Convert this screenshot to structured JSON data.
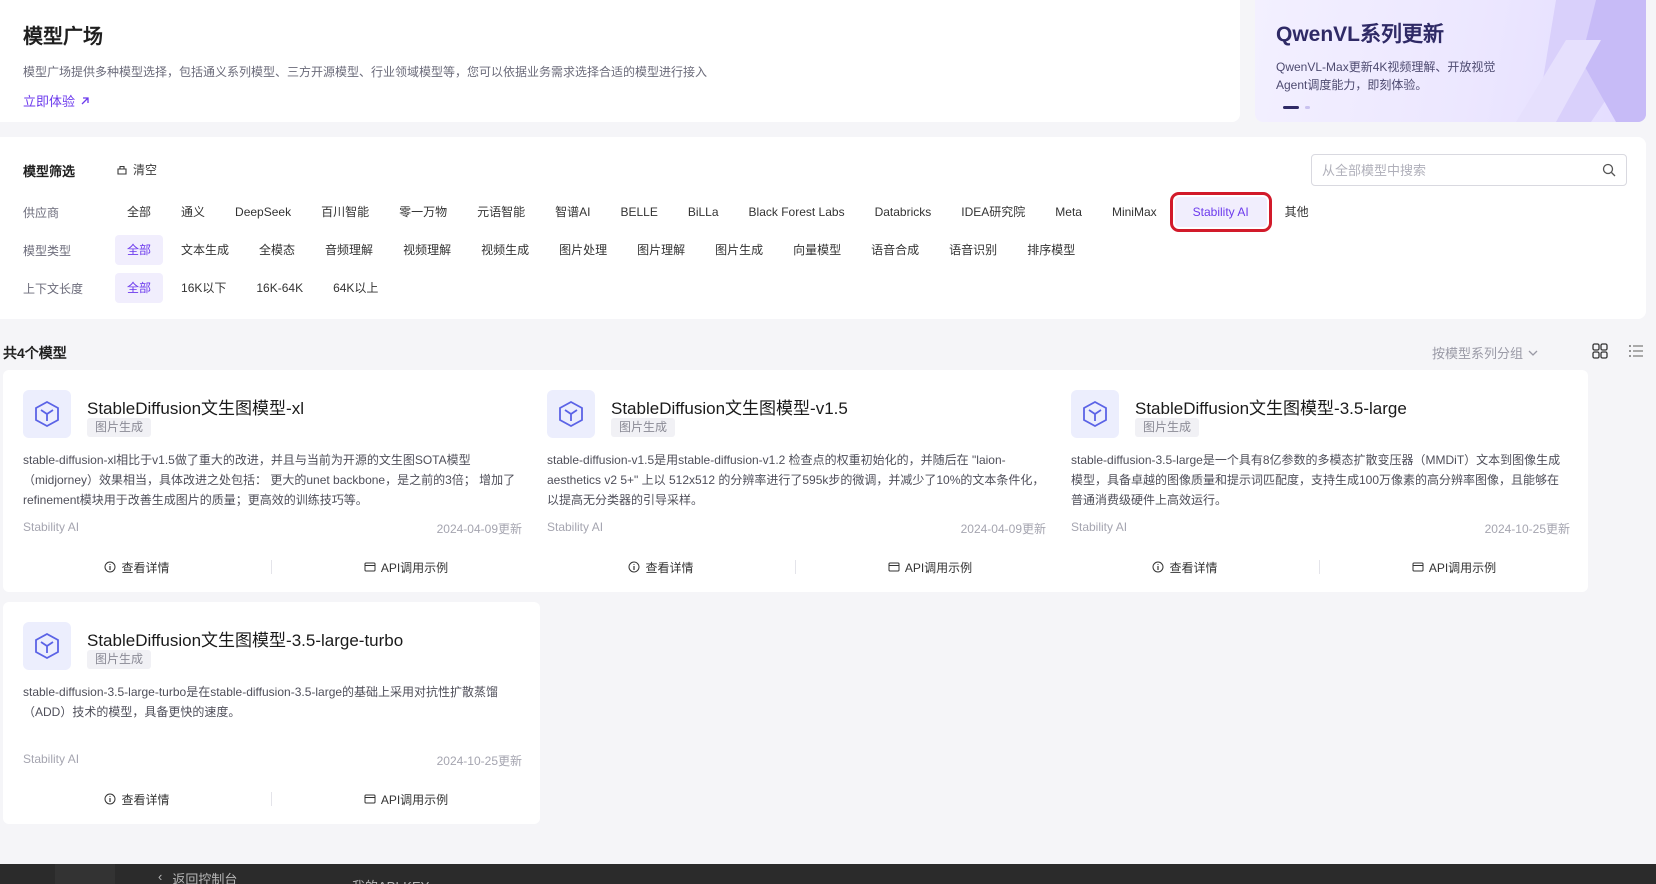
{
  "hero": {
    "title": "模型广场",
    "description": "模型广场提供多种模型选择，包括通义系列模型、三方开源模型、行业领域模型等，您可以依据业务需求选择合适的模型进行接入",
    "try_link": "立即体验"
  },
  "banner": {
    "title": "QwenVL系列更新",
    "text": "QwenVL-Max更新4K视频理解、开放视觉Agent调度能力，即刻体验。"
  },
  "filter": {
    "title": "模型筛选",
    "clear": "清空",
    "search_placeholder": "从全部模型中搜索",
    "provider_label": "供应商",
    "providers": [
      "全部",
      "通义",
      "DeepSeek",
      "百川智能",
      "零一万物",
      "元语智能",
      "智谱AI",
      "BELLE",
      "BiLLa",
      "Black Forest Labs",
      "Databricks",
      "IDEA研究院",
      "Meta",
      "MiniMax",
      "Stability AI",
      "其他"
    ],
    "selected_provider": "Stability AI",
    "type_label": "模型类型",
    "types": [
      "全部",
      "文本生成",
      "全模态",
      "音频理解",
      "视频理解",
      "视频生成",
      "图片处理",
      "图片理解",
      "图片生成",
      "向量模型",
      "语音合成",
      "语音识别",
      "排序模型"
    ],
    "selected_type": "全部",
    "context_label": "上下文长度",
    "contexts": [
      "全部",
      "16K以下",
      "16K-64K",
      "64K以上"
    ],
    "selected_context": "全部"
  },
  "list": {
    "count_text": "共4个模型",
    "group_by": "按模型系列分组"
  },
  "cards": [
    {
      "name": "StableDiffusion文生图模型-xl",
      "tag": "图片生成",
      "description": "stable-diffusion-xl相比于v1.5做了重大的改进，并且与当前为开源的文生图SOTA模型（midjorney）效果相当，具体改进之处包括： 更大的unet backbone，是之前的3倍； 增加了refinement模块用于改善生成图片的质量；更高效的训练技巧等。",
      "provider": "Stability AI",
      "updated": "2024-04-09更新",
      "detail": "查看详情",
      "api": "API调用示例"
    },
    {
      "name": "StableDiffusion文生图模型-v1.5",
      "tag": "图片生成",
      "description": "stable-diffusion-v1.5是用stable-diffusion-v1.2 检查点的权重初始化的，并随后在 \"laion-aesthetics v2 5+\" 上以 512x512 的分辨率进行了595k步的微调，并减少了10%的文本条件化，以提高无分类器的引导采样。",
      "provider": "Stability AI",
      "updated": "2024-04-09更新",
      "detail": "查看详情",
      "api": "API调用示例"
    },
    {
      "name": "StableDiffusion文生图模型-3.5-large",
      "tag": "图片生成",
      "description": "stable-diffusion-3.5-large是一个具有8亿参数的多模态扩散变压器（MMDiT）文本到图像生成模型，具备卓越的图像质量和提示词匹配度，支持生成100万像素的高分辨率图像，且能够在普通消费级硬件上高效运行。",
      "provider": "Stability AI",
      "updated": "2024-10-25更新",
      "detail": "查看详情",
      "api": "API调用示例"
    },
    {
      "name": "StableDiffusion文生图模型-3.5-large-turbo",
      "tag": "图片生成",
      "description": "stable-diffusion-3.5-large-turbo是在stable-diffusion-3.5-large的基础上采用对抗性扩散蒸馏（ADD）技术的模型，具备更快的速度。",
      "provider": "Stability AI",
      "updated": "2024-10-25更新",
      "detail": "查看详情",
      "api": "API调用示例"
    }
  ],
  "bottom": {
    "back": "返回控制台",
    "apikey": "我的API-KEY"
  },
  "colors": {
    "accent": "#6c3aed",
    "highlight_box": "#d21a2a"
  }
}
